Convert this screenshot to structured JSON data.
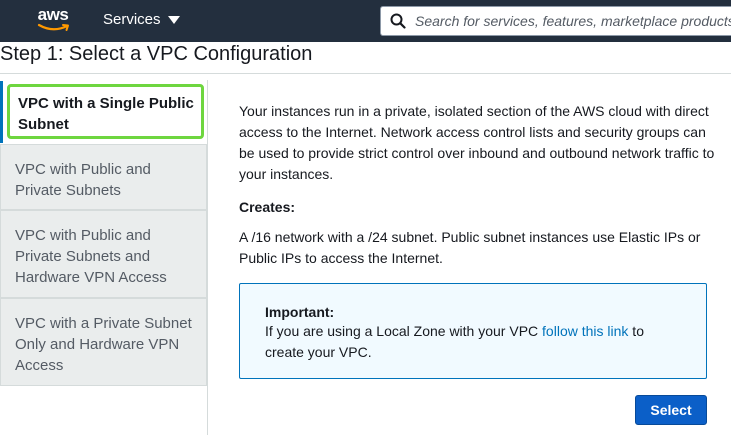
{
  "nav": {
    "logo_text": "aws",
    "services_label": "Services",
    "search_placeholder": "Search for services, features, marketplace products, and docs"
  },
  "page": {
    "title": "Step 1: Select a VPC Configuration"
  },
  "options": [
    {
      "label": "VPC with a Single Public Subnet",
      "selected": true
    },
    {
      "label": "VPC with Public and Private Subnets",
      "selected": false
    },
    {
      "label": "VPC with Public and Private Subnets and Hardware VPN Access",
      "selected": false
    },
    {
      "label": "VPC with a Private Subnet Only and Hardware VPN Access",
      "selected": false
    }
  ],
  "detail": {
    "description": "Your instances run in a private, isolated section of the AWS cloud with direct access to the Internet. Network access control lists and security groups can be used to provide strict control over inbound and outbound network traffic to your instances.",
    "creates_label": "Creates:",
    "creates_text": "A /16 network with a /24 subnet. Public subnet instances use Elastic IPs or Public IPs to access the Internet.",
    "important": {
      "title": "Important:",
      "text_before": "If you are using a Local Zone with your VPC ",
      "link_text": "follow this link",
      "text_after": " to create your VPC."
    },
    "select_label": "Select"
  },
  "colors": {
    "nav_bg": "#232f3e",
    "focus_ring": "#6ed63f",
    "link": "#0073bb",
    "primary_button": "#0b5fc8",
    "info_bg": "#f1faff"
  },
  "icons": {
    "search": "search-icon",
    "caret": "caret-down-icon",
    "logo": "aws-logo"
  }
}
